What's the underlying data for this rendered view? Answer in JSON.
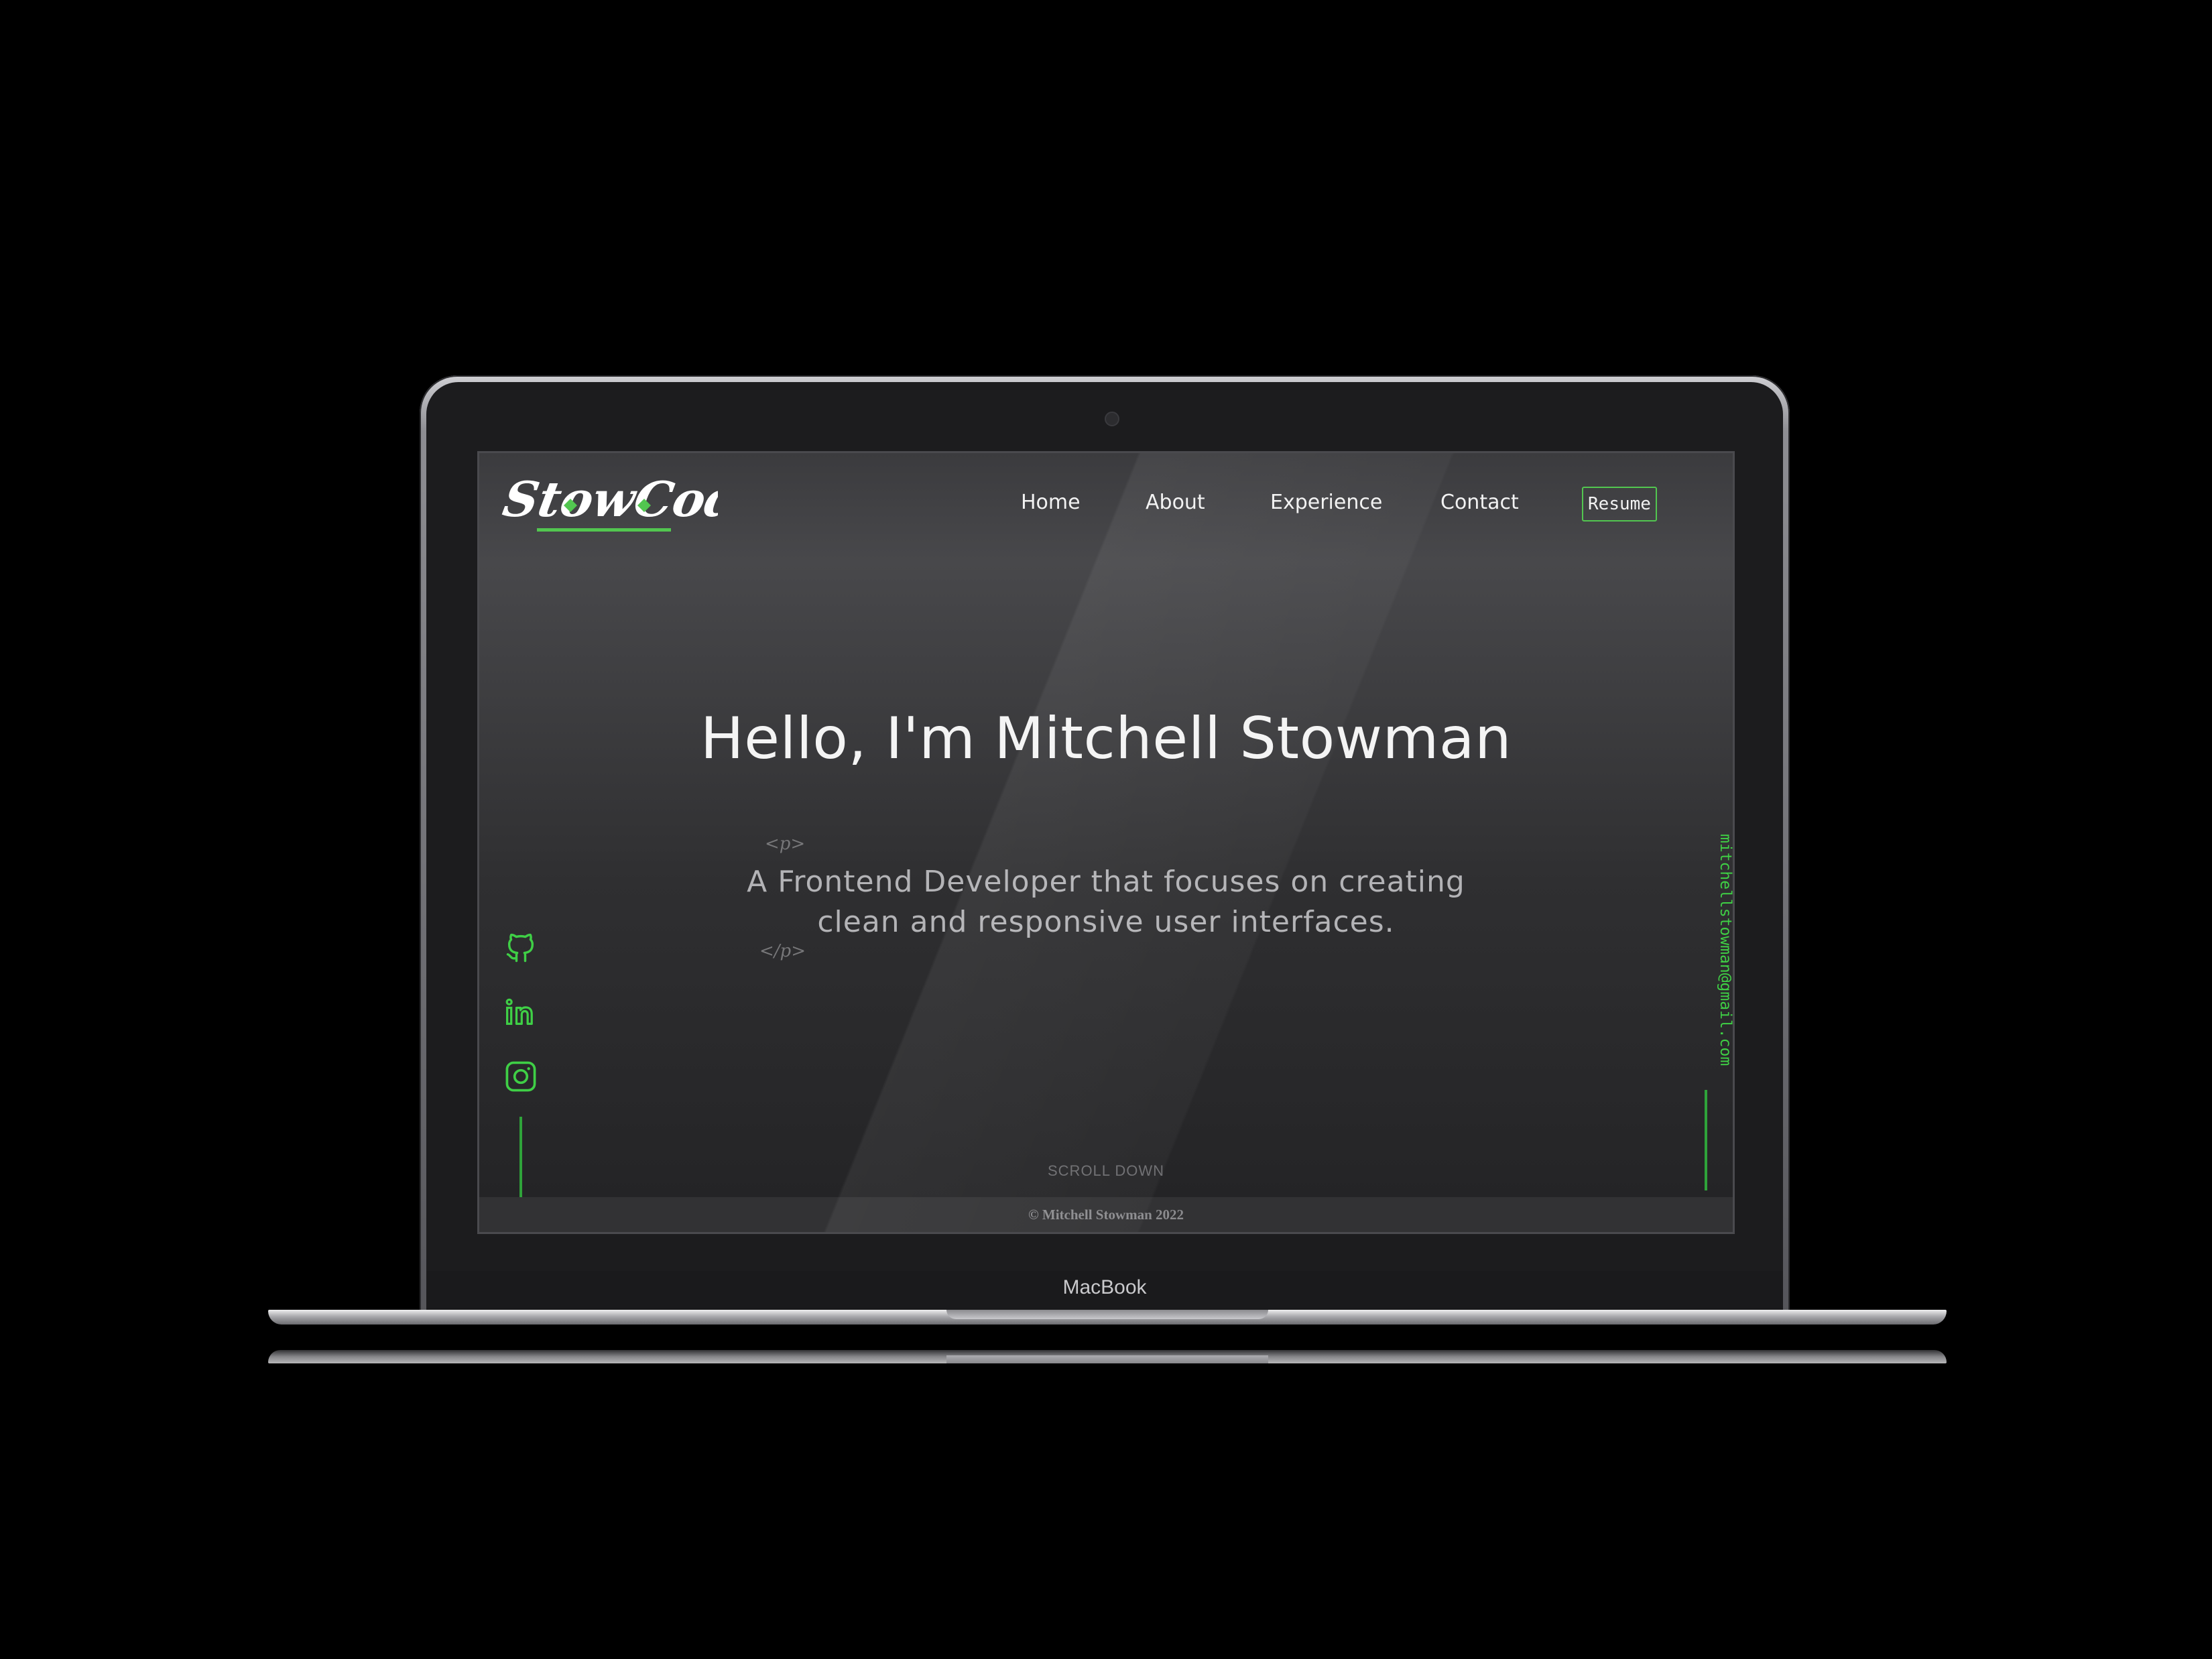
{
  "device": {
    "label": "MacBook"
  },
  "site": {
    "logo": {
      "text": "StowCode",
      "accent": "#52c650"
    },
    "nav": {
      "items": [
        {
          "label": "Home"
        },
        {
          "label": "About"
        },
        {
          "label": "Experience"
        },
        {
          "label": "Contact"
        }
      ],
      "resume_label": "Resume"
    },
    "hero": {
      "title": "Hello, I'm Mitchell Stowman",
      "open_tag": "<p>",
      "close_tag": "</p>",
      "subtitle_line1": "A Frontend Developer that focuses on creating",
      "subtitle_line2": "clean and responsive user interfaces."
    },
    "socials": [
      {
        "icon": "github-icon"
      },
      {
        "icon": "linkedin-icon"
      },
      {
        "icon": "instagram-icon"
      }
    ],
    "email": "mitchellstowman@gmail.com",
    "scroll_label": "SCROLL DOWN",
    "footer": "© Mitchell Stowman 2022"
  },
  "colors": {
    "accent": "#52c650",
    "background": "#2e2e30",
    "text": "#f2f2f2"
  }
}
